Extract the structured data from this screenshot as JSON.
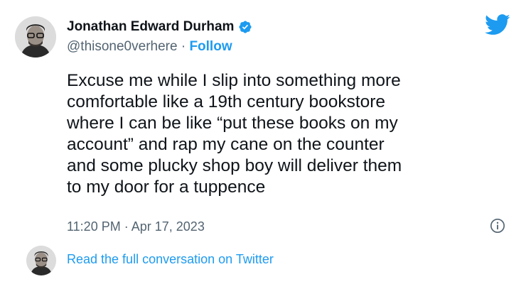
{
  "tweet": {
    "author_name": "Jonathan Edward Durham",
    "handle": "@thisone0verhere",
    "separator": "·",
    "follow_label": "Follow",
    "text": "Excuse me while I slip into something more\ncomfortable like a 19th century bookstore\nwhere I can be like “put these books on my\naccount” and rap my cane on the counter\nand some plucky shop boy will deliver them\nto my door for a tuppence",
    "time": "11:20 PM",
    "date": "Apr 17, 2023",
    "read_more_label": "Read the full conversation on Twitter"
  },
  "icons": {
    "verified": "verified-badge-icon",
    "brand": "twitter-bird-icon",
    "info": "info-icon"
  },
  "colors": {
    "accent": "#1d9bf0",
    "text": "#0f1419",
    "secondary": "#536471"
  }
}
